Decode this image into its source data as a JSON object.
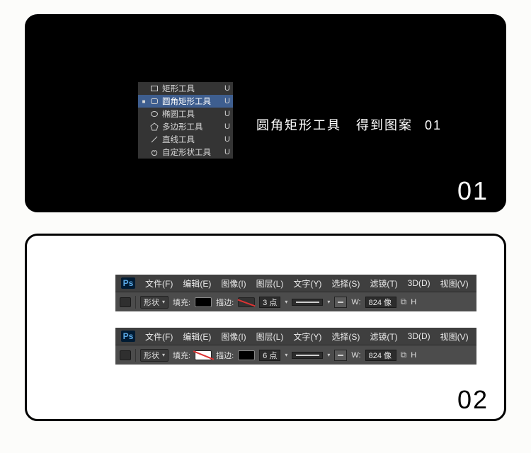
{
  "step1": {
    "number": "01",
    "caption": {
      "seg1": "圆角矩形工具",
      "seg2": "得到图案",
      "seg3": "01"
    },
    "tool_menu": [
      {
        "label": "矩形工具",
        "key": "U",
        "selected": false,
        "icon": "rect"
      },
      {
        "label": "圆角矩形工具",
        "key": "U",
        "selected": true,
        "icon": "roundrect"
      },
      {
        "label": "椭圆工具",
        "key": "U",
        "selected": false,
        "icon": "ellipse"
      },
      {
        "label": "多边形工具",
        "key": "U",
        "selected": false,
        "icon": "polygon"
      },
      {
        "label": "直线工具",
        "key": "U",
        "selected": false,
        "icon": "line"
      },
      {
        "label": "自定形状工具",
        "key": "U",
        "selected": false,
        "icon": "custom"
      }
    ]
  },
  "step2": {
    "number": "02",
    "menubar": [
      {
        "label": "文件(F)"
      },
      {
        "label": "编辑(E)"
      },
      {
        "label": "图像(I)"
      },
      {
        "label": "图层(L)"
      },
      {
        "label": "文字(Y)"
      },
      {
        "label": "选择(S)"
      },
      {
        "label": "滤镜(T)"
      },
      {
        "label": "3D(D)"
      },
      {
        "label": "视图(V)"
      }
    ],
    "ps_logo": "Ps",
    "optbar_a": {
      "mode_label": "形状",
      "fill_label": "填充:",
      "fill_style": "black",
      "stroke_label": "描边:",
      "stroke_style": "none",
      "stroke_pt": "3 点",
      "w_label": "W:",
      "w_value": "824 像",
      "link": "⧉",
      "h_label": "H"
    },
    "optbar_b": {
      "mode_label": "形状",
      "fill_label": "填充:",
      "fill_style": "nonefull",
      "stroke_label": "描边:",
      "stroke_style": "black",
      "stroke_pt": "6 点",
      "w_label": "W:",
      "w_value": "824 像",
      "link": "⧉",
      "h_label": "H"
    }
  }
}
